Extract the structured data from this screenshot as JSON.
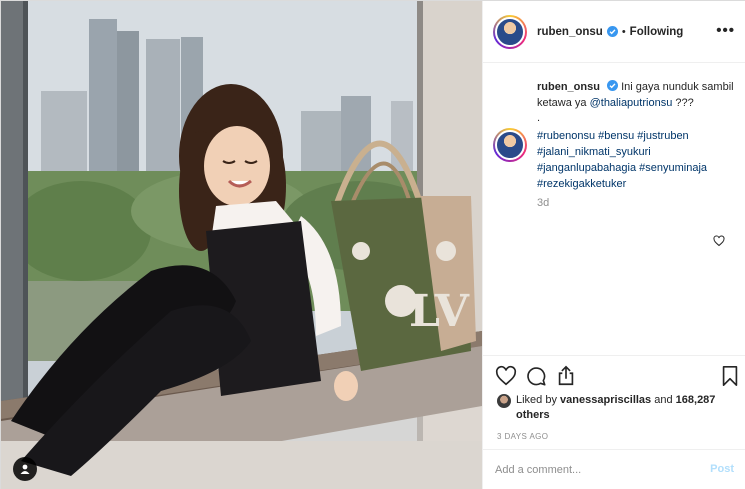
{
  "header": {
    "username": "ruben_onsu",
    "verified": true,
    "separator": "•",
    "follow_status": "Following",
    "more_icon": "•••"
  },
  "caption": {
    "username": "ruben_onsu",
    "text": "Ini gaya nunduk sambil ketawa ya",
    "mention": "@thaliaputrionsu",
    "suffix": "???",
    "dot": "."
  },
  "comment": {
    "hashtags": "#rubenonsu #bensu #justruben #jalani_nikmati_syukuri #janganlupabahagia #senyuminaja #rezekigakketuker"
  },
  "time_ago": "3d",
  "likes": {
    "prefix": "Liked by",
    "user": "vanessapriscillas",
    "conjunction": "and",
    "count": "168,287 others"
  },
  "post_date": "3 DAYS AGO",
  "add_comment": {
    "placeholder": "Add a comment...",
    "post_label": "Post"
  },
  "icons": {
    "like": "heart-icon",
    "comment": "comment-icon",
    "share": "share-icon",
    "save": "bookmark-icon",
    "photo_user": "user-icon"
  },
  "colors": {
    "text": "#262626",
    "link": "#003569",
    "muted": "#8e8e8e",
    "post_disabled": "#b2dffc",
    "verified": "#3897f0"
  }
}
